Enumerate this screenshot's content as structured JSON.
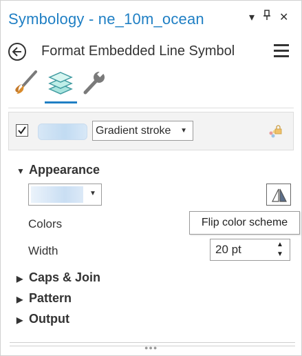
{
  "header": {
    "title": "Symbology - ne_10m_ocean",
    "controls": {
      "menu_glyph": "▾",
      "pin_glyph": "⊥",
      "close_glyph": "✕"
    }
  },
  "subheader": {
    "title": "Format Embedded Line Symbol",
    "back_icon": "back-arrow-icon",
    "menu_icon": "hamburger-menu-icon"
  },
  "tabs": [
    {
      "name": "properties",
      "icon": "paintbrush-icon",
      "active": false
    },
    {
      "name": "layers",
      "icon": "layers-icon",
      "active": true
    },
    {
      "name": "structure",
      "icon": "wrench-icon",
      "active": false
    }
  ],
  "symbol_layer": {
    "checked": true,
    "type_label": "Gradient stroke",
    "lock_icon": "color-lock-icon"
  },
  "appearance": {
    "heading": "Appearance",
    "colors_label": "Colors",
    "flip_tooltip": "Flip color scheme",
    "width_label": "Width",
    "width_value": "20 pt"
  },
  "sections": [
    {
      "label": "Caps & Join",
      "expanded": false
    },
    {
      "label": "Pattern",
      "expanded": false
    },
    {
      "label": "Output",
      "expanded": false
    }
  ],
  "colors": {
    "accent": "#1f7fc4",
    "gradient_light": "#ebf3fb",
    "gradient_mid": "#c9def3"
  }
}
